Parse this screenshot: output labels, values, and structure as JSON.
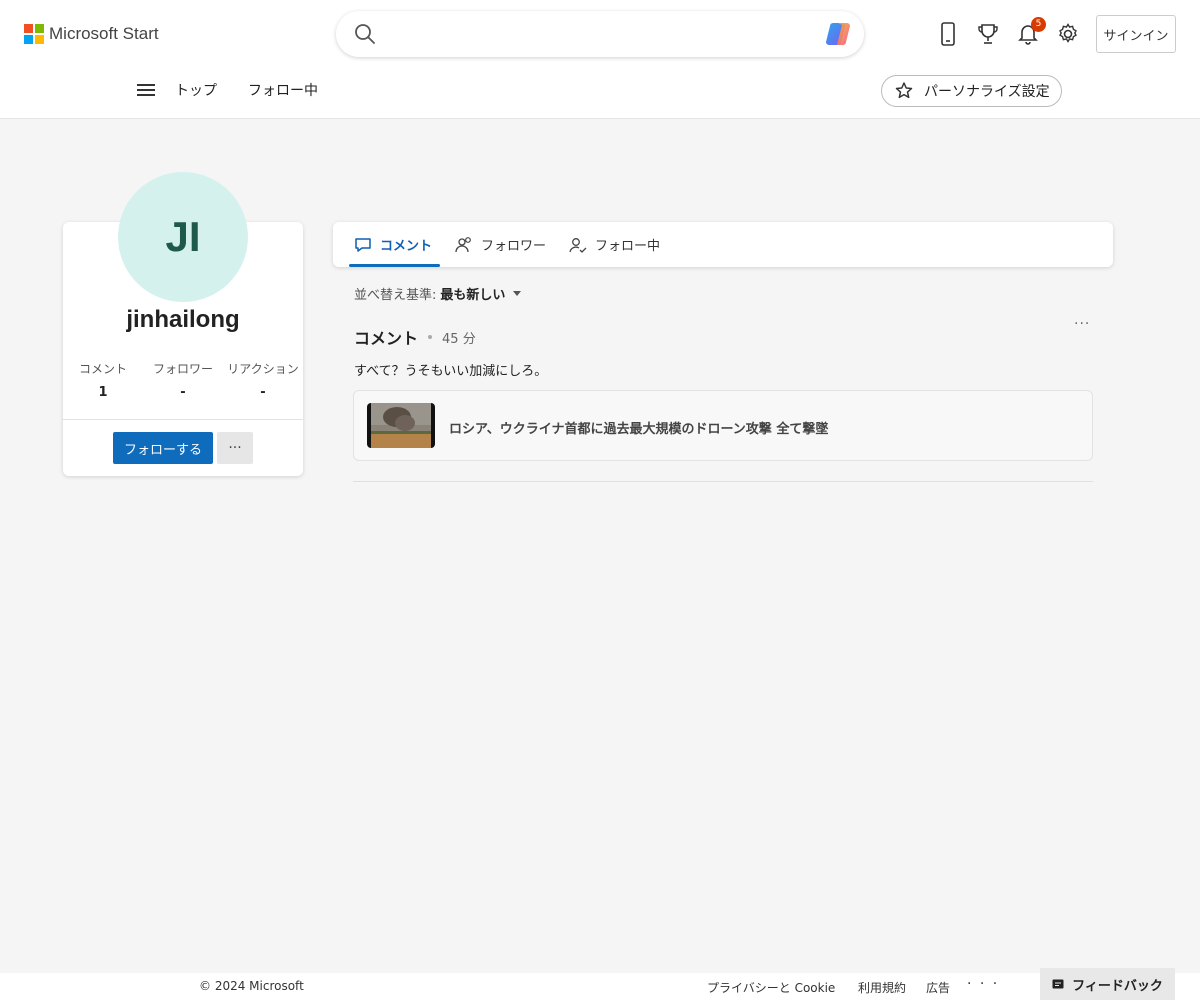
{
  "header": {
    "brand": "Microsoft Start",
    "search_placeholder": "",
    "notification_count": "5",
    "signin_label": "サインイン",
    "icons": [
      "search-icon",
      "copilot-icon",
      "phone-icon",
      "trophy-icon",
      "bell-icon",
      "gear-icon"
    ]
  },
  "nav": {
    "items": [
      {
        "label": "トップ"
      },
      {
        "label": "フォロー中"
      }
    ],
    "personalize_label": "パーソナライズ設定"
  },
  "profile": {
    "initials": "JI",
    "username": "jinhailong",
    "stats": [
      {
        "label": "コメント",
        "value": "1"
      },
      {
        "label": "フォロワー",
        "value": "-"
      },
      {
        "label": "リアクション",
        "value": "-"
      }
    ],
    "follow_label": "フォローする",
    "more_label": "···",
    "avatar_color": "#d4f1ee"
  },
  "tabs": [
    {
      "label": "コメント",
      "active": true
    },
    {
      "label": "フォロワー",
      "active": false
    },
    {
      "label": "フォロー中",
      "active": false
    }
  ],
  "sort": {
    "prefix": "並べ替え基準:",
    "value": "最も新しい"
  },
  "comment": {
    "title": "コメント",
    "time": "45 分",
    "more_label": "···",
    "text": "すべて？うそもいい加減にしろ。",
    "article_title": "ロシア、ウクライナ首都に過去最大規模のドローン攻撃 全て撃墜"
  },
  "footer": {
    "copyright": "© 2024 Microsoft",
    "links": [
      {
        "label": "プライバシーと Cookie"
      },
      {
        "label": "利用規約"
      },
      {
        "label": "広告"
      }
    ],
    "more_label": "· · ·",
    "feedback_label": "フィードバック"
  },
  "colors": {
    "accent": "#0f6cbd",
    "badge": "#d83b01",
    "background": "#f5f5f5"
  }
}
